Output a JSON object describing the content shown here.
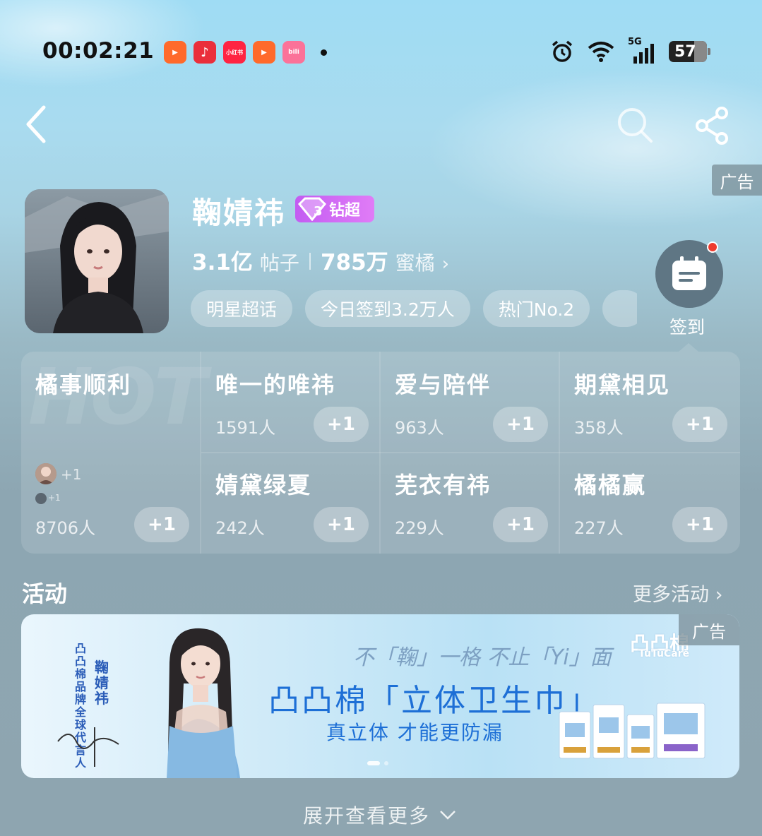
{
  "status_bar": {
    "time": "00:02:21",
    "apps": [
      {
        "name": "kuaishou-app-icon",
        "color": "#ff6a2b",
        "glyph": "▶"
      },
      {
        "name": "music-app-icon",
        "color": "#ea2f3b",
        "glyph": "♪"
      },
      {
        "name": "xiaohongshu-app-icon",
        "color": "#ff2442",
        "glyph": "小红书"
      },
      {
        "name": "kuaishou-app-icon-2",
        "color": "#ff6a2b",
        "glyph": "▶"
      },
      {
        "name": "bilibili-app-icon",
        "color": "#fb7299",
        "glyph": "bili"
      }
    ],
    "network": "5G",
    "battery": "57"
  },
  "header": {
    "ad_tag": "广告"
  },
  "profile": {
    "name": "鞠婧祎",
    "badge_level": "3",
    "badge_label": "钻超",
    "posts_count": "3.1亿",
    "posts_label": "帖子",
    "fans_count": "785万",
    "fans_label": "蜜橘",
    "chips": [
      "明星超话",
      "今日签到3.2万人",
      "热门No.2",
      ""
    ],
    "checkin_label": "签到"
  },
  "groups": {
    "watermark": "HOT",
    "featured": {
      "title": "橘事顺利",
      "mini1": "+1",
      "mini2": "+1",
      "count": "8706人",
      "plus": "+1"
    },
    "items": [
      {
        "title": "唯一的唯祎",
        "count": "1591人",
        "plus": "+1"
      },
      {
        "title": "爱与陪伴",
        "count": "963人",
        "plus": "+1"
      },
      {
        "title": "期黛相见",
        "count": "358人",
        "plus": "+1"
      },
      {
        "title": "婧黛绿夏",
        "count": "242人",
        "plus": "+1"
      },
      {
        "title": "芜衣有祎",
        "count": "229人",
        "plus": "+1"
      },
      {
        "title": "橘橘赢",
        "count": "227人",
        "plus": "+1"
      }
    ]
  },
  "activity": {
    "title": "活动",
    "more": "更多活动",
    "banner": {
      "ad_tag": "广告",
      "brand_vertical": "凸凸棉品牌全球代言人",
      "name_vertical": "鞠婧祎",
      "slogan_small": "不「鞠」一格 不止「Yi」面",
      "headline": "凸凸棉「立体卫生巾」",
      "subline": "真立体 才能更防漏",
      "logo": "凸凸棉",
      "logo_sub": "TuTuCare"
    }
  },
  "footer": {
    "expand": "展开查看更多"
  }
}
